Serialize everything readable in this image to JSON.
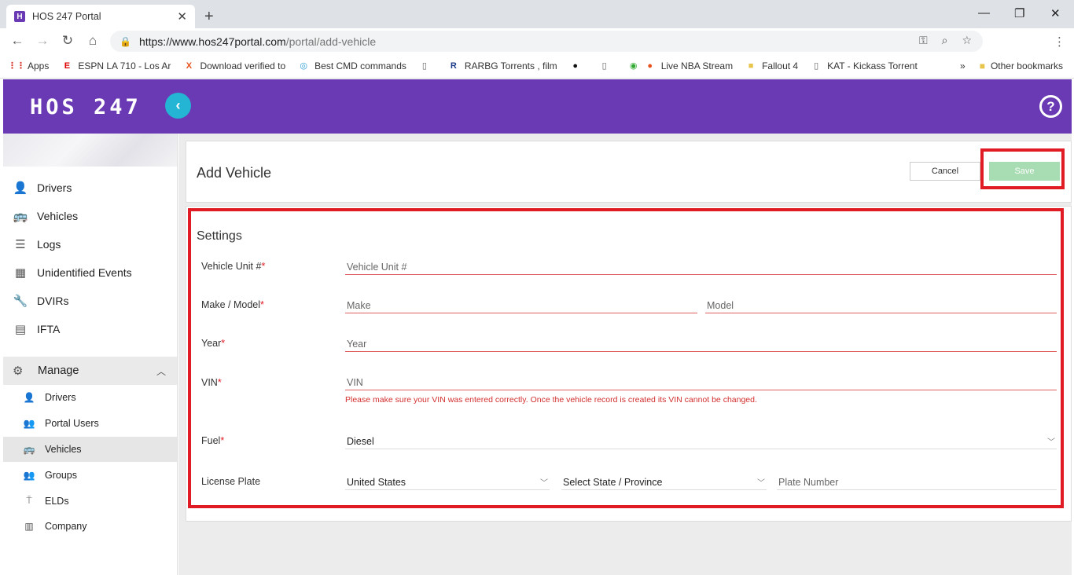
{
  "browser": {
    "tab_title": "HOS 247 Portal",
    "tab_favicon_letter": "H",
    "url_base": "https://www.hos247portal.com",
    "url_path": "/portal/add-vehicle",
    "bookmarks": [
      {
        "label": "Apps",
        "icon": "apps-grid-icon"
      },
      {
        "label": "ESPN LA 710 - Los Ar",
        "icon": "espn-icon"
      },
      {
        "label": "Download verified to",
        "icon": "x-icon"
      },
      {
        "label": "Best CMD commands",
        "icon": "cmd-icon"
      },
      {
        "label": "",
        "icon": "page-icon"
      },
      {
        "label": "RARBG Torrents , film",
        "icon": "r-icon"
      },
      {
        "label": "",
        "icon": "spotify-icon"
      },
      {
        "label": "",
        "icon": "page-icon"
      },
      {
        "label": "Live NBA Stream",
        "icon": "basketball-icon"
      },
      {
        "label": "Fallout 4",
        "icon": "folder-icon"
      },
      {
        "label": "KAT - Kickass Torrent",
        "icon": "page-icon"
      }
    ],
    "more_bookmarks": "»",
    "other_bookmarks": "Other bookmarks"
  },
  "app": {
    "logo": "HOS 247",
    "help_symbol": "?"
  },
  "sidebar": {
    "items": [
      {
        "label": "Drivers",
        "icon": "person-icon"
      },
      {
        "label": "Vehicles",
        "icon": "bus-icon"
      },
      {
        "label": "Logs",
        "icon": "list-icon"
      },
      {
        "label": "Unidentified Events",
        "icon": "calendar-icon"
      },
      {
        "label": "DVIRs",
        "icon": "wrench-icon"
      },
      {
        "label": "IFTA",
        "icon": "ifta-icon"
      }
    ],
    "manage": {
      "label": "Manage",
      "sub_items": [
        {
          "label": "Drivers",
          "icon": "person-icon"
        },
        {
          "label": "Portal Users",
          "icon": "users-icon"
        },
        {
          "label": "Vehicles",
          "icon": "bus-icon",
          "active": true
        },
        {
          "label": "Groups",
          "icon": "group-icon"
        },
        {
          "label": "ELDs",
          "icon": "eld-icon"
        },
        {
          "label": "Company",
          "icon": "building-icon"
        }
      ]
    }
  },
  "page": {
    "title": "Add Vehicle",
    "cancel_label": "Cancel",
    "save_label": "Save"
  },
  "settings": {
    "title": "Settings",
    "vehicle_unit": {
      "label": "Vehicle Unit #",
      "placeholder": "Vehicle Unit #"
    },
    "make_model": {
      "label": "Make / Model",
      "make_placeholder": "Make",
      "model_placeholder": "Model"
    },
    "year": {
      "label": "Year",
      "placeholder": "Year"
    },
    "vin": {
      "label": "VIN",
      "placeholder": "VIN",
      "warning": "Please make sure your VIN was entered correctly. Once the vehicle record is created its VIN cannot be changed."
    },
    "fuel": {
      "label": "Fuel",
      "value": "Diesel"
    },
    "license_plate": {
      "label": "License Plate",
      "country": "United States",
      "state_placeholder": "Select State / Province",
      "plate_placeholder": "Plate Number"
    },
    "required_mark": "*"
  },
  "colors": {
    "brand": "#6a3ab4",
    "accent": "#23b5d3",
    "highlight": "#e01b24",
    "save_disabled": "#a8dcb2"
  }
}
